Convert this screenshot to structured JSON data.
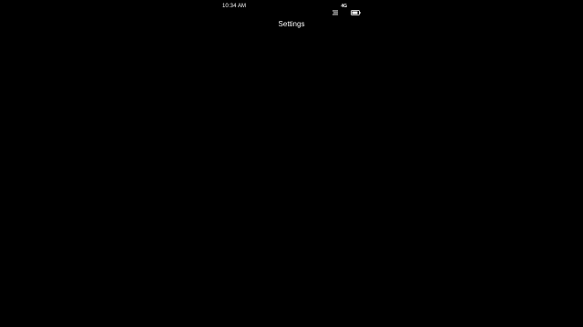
{
  "status_bar": {
    "time": "10:34 AM",
    "network": "4G",
    "signal_icon": "signal-bars-icon",
    "battery_icon": "battery-icon"
  },
  "header": {
    "title": "Settings"
  },
  "colors": {
    "background": "#000000",
    "text": "#ffffff"
  }
}
